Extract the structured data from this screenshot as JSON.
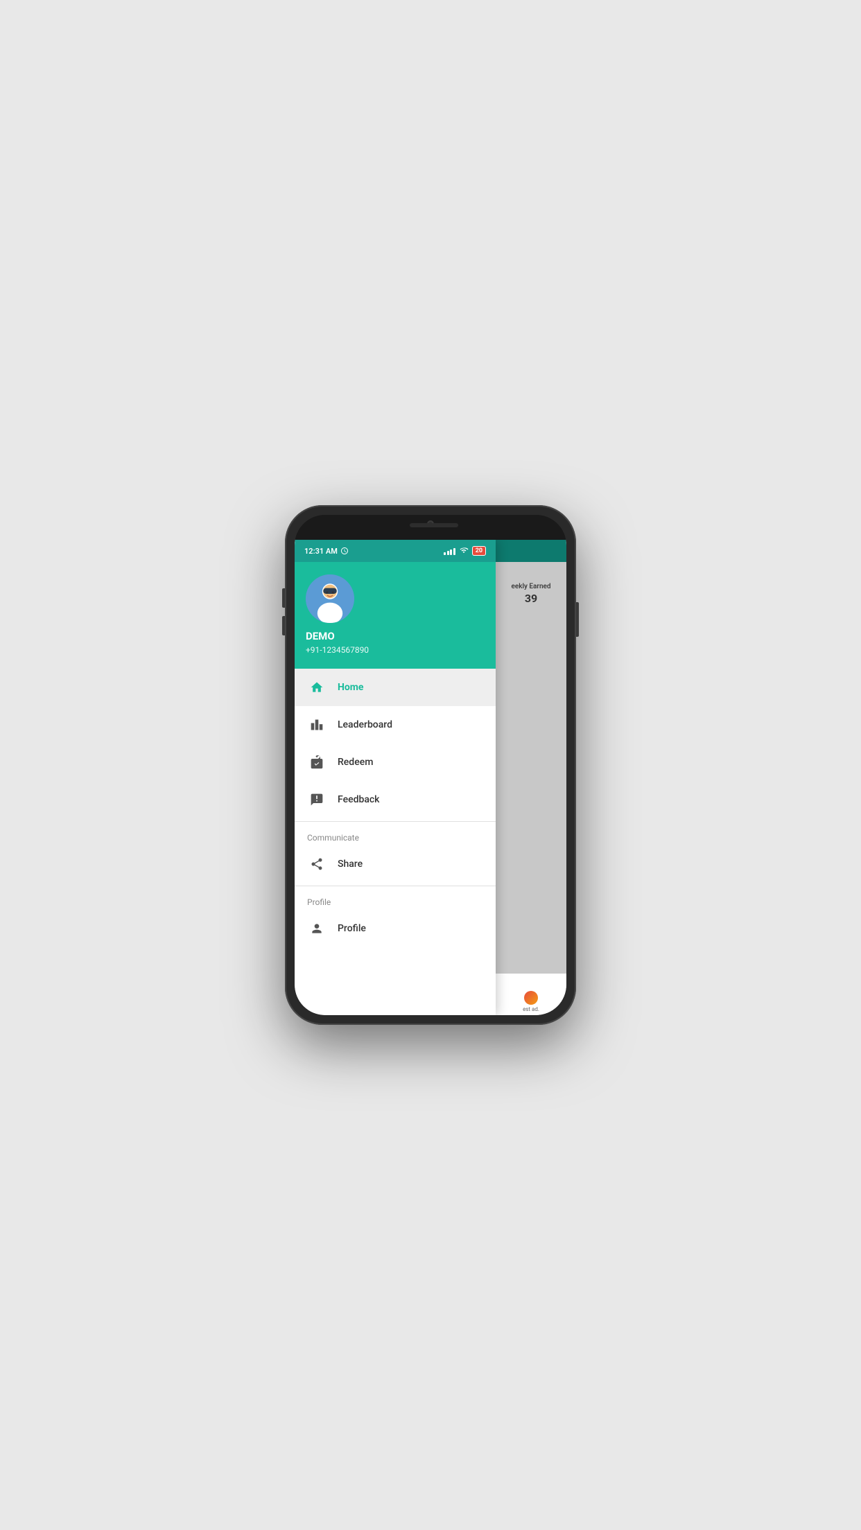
{
  "statusBar": {
    "time": "12:31 AM",
    "battery": "20"
  },
  "profile": {
    "name": "DEMO",
    "phone": "+91-1234567890"
  },
  "menuItems": [
    {
      "id": "home",
      "label": "Home",
      "icon": "home",
      "active": true
    },
    {
      "id": "leaderboard",
      "label": "Leaderboard",
      "icon": "leaderboard",
      "active": false
    },
    {
      "id": "redeem",
      "label": "Redeem",
      "icon": "redeem",
      "active": false
    },
    {
      "id": "feedback",
      "label": "Feedback",
      "icon": "feedback",
      "active": false
    }
  ],
  "sections": [
    {
      "title": "Communicate",
      "items": [
        {
          "id": "share",
          "label": "Share",
          "icon": "share"
        }
      ]
    },
    {
      "title": "Profile",
      "items": [
        {
          "id": "profile",
          "label": "Profile",
          "icon": "profile"
        }
      ]
    }
  ],
  "peek": {
    "earnedLabel": "eekly Earned",
    "earnedValue": "39"
  }
}
